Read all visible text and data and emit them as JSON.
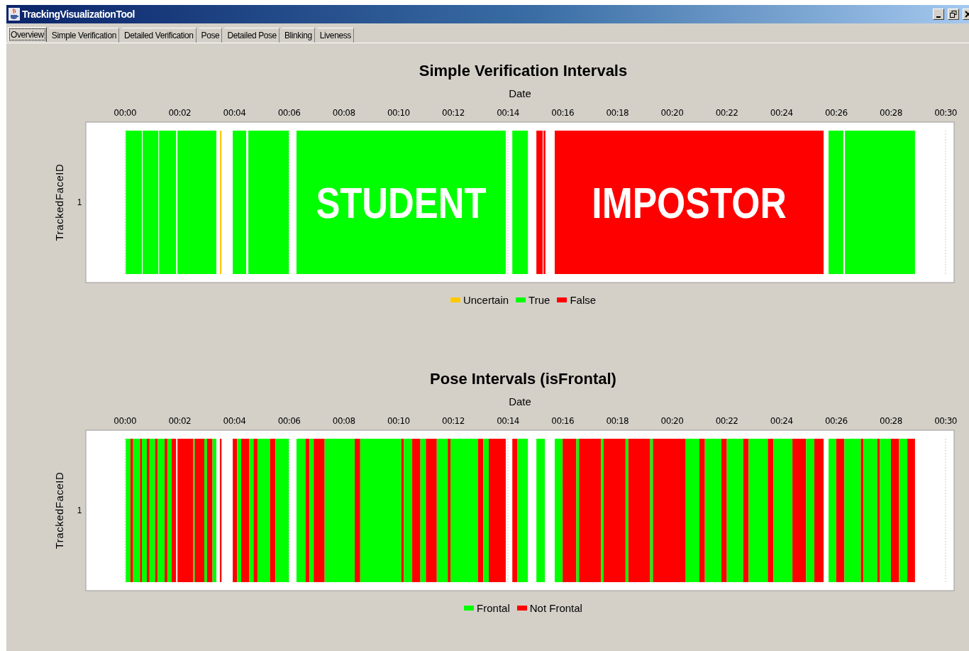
{
  "window": {
    "title": "TrackingVisualizationTool"
  },
  "tabs": [
    {
      "label": "Overview",
      "selected": true
    },
    {
      "label": "Simple Verification",
      "selected": false
    },
    {
      "label": "Detailed Verification",
      "selected": false
    },
    {
      "label": "Pose",
      "selected": false
    },
    {
      "label": "Detailed Pose",
      "selected": false
    },
    {
      "label": "Blinking",
      "selected": false
    },
    {
      "label": "Liveness",
      "selected": false
    }
  ],
  "charts": [
    {
      "legend": [
        {
          "name": "Uncertain",
          "color": "#ffc800"
        },
        {
          "name": "True",
          "color": "#00ff00"
        },
        {
          "name": "False",
          "color": "#ff0000"
        }
      ],
      "chart_data": {
        "type": "bar",
        "orientation": "horizontal",
        "grid": true,
        "title": "Simple Verification Intervals",
        "xlabel": "Date",
        "ylabel": "TrackedFaceID",
        "categories": [
          "1"
        ],
        "xlim": [
          -1.43,
          30.31
        ],
        "xticks": [
          {
            "value": 0,
            "label": "00:00"
          },
          {
            "value": 2,
            "label": "00:02"
          },
          {
            "value": 4,
            "label": "00:04"
          },
          {
            "value": 6,
            "label": "00:06"
          },
          {
            "value": 8,
            "label": "00:08"
          },
          {
            "value": 10,
            "label": "00:10"
          },
          {
            "value": 12,
            "label": "00:12"
          },
          {
            "value": 14,
            "label": "00:14"
          },
          {
            "value": 16,
            "label": "00:16"
          },
          {
            "value": 18,
            "label": "00:18"
          },
          {
            "value": 20,
            "label": "00:20"
          },
          {
            "value": 22,
            "label": "00:22"
          },
          {
            "value": 24,
            "label": "00:24"
          },
          {
            "value": 26,
            "label": "00:26"
          },
          {
            "value": 28,
            "label": "00:28"
          },
          {
            "value": 30,
            "label": "00:30"
          }
        ],
        "bands": [
          {
            "axis": "x",
            "from": 0.03,
            "to": 0.62,
            "color": "#00ff00"
          },
          {
            "axis": "x",
            "from": 0.65,
            "to": 1.22,
            "color": "#00ff00"
          },
          {
            "axis": "x",
            "from": 1.25,
            "to": 1.87,
            "color": "#00ff00"
          },
          {
            "axis": "x",
            "from": 1.92,
            "to": 3.34,
            "color": "#00ff00"
          },
          {
            "axis": "x",
            "from": 3.47,
            "to": 3.53,
            "color": "#ffc800"
          },
          {
            "axis": "x",
            "from": 3.94,
            "to": 4.43,
            "color": "#00ff00"
          },
          {
            "axis": "x",
            "from": 4.51,
            "to": 5.99,
            "color": "#00ff00"
          },
          {
            "axis": "x",
            "from": 6.27,
            "to": 13.92,
            "color": "#00ff00"
          },
          {
            "axis": "x",
            "from": 14.16,
            "to": 14.73,
            "color": "#00ff00"
          },
          {
            "axis": "x",
            "from": 15.04,
            "to": 15.27,
            "color": "#ff0000"
          },
          {
            "axis": "x",
            "from": 15.3,
            "to": 15.37,
            "color": "#ff0000"
          },
          {
            "axis": "x",
            "from": 15.71,
            "to": 25.54,
            "color": "#ff0000"
          },
          {
            "axis": "x",
            "from": 25.72,
            "to": 26.26,
            "color": "#00ff00"
          },
          {
            "axis": "x",
            "from": 26.32,
            "to": 28.88,
            "color": "#00ff00"
          }
        ],
        "annotations": [
          "STUDENT",
          "IMPOSTOR"
        ]
      }
    },
    {
      "legend": [
        {
          "name": "Frontal",
          "color": "#00ff00"
        },
        {
          "name": "Not Frontal",
          "color": "#ff0000"
        }
      ],
      "chart_data": {
        "type": "bar",
        "orientation": "horizontal",
        "grid": true,
        "title": "Pose Intervals (isFrontal)",
        "xlabel": "Date",
        "ylabel": "TrackedFaceID",
        "categories": [
          "1"
        ],
        "xlim": [
          -1.43,
          30.31
        ],
        "xticks": [
          {
            "value": 0,
            "label": "00:00"
          },
          {
            "value": 2,
            "label": "00:02"
          },
          {
            "value": 4,
            "label": "00:04"
          },
          {
            "value": 6,
            "label": "00:06"
          },
          {
            "value": 8,
            "label": "00:08"
          },
          {
            "value": 10,
            "label": "00:10"
          },
          {
            "value": 12,
            "label": "00:12"
          },
          {
            "value": 14,
            "label": "00:14"
          },
          {
            "value": 16,
            "label": "00:16"
          },
          {
            "value": 18,
            "label": "00:18"
          },
          {
            "value": 20,
            "label": "00:20"
          },
          {
            "value": 22,
            "label": "00:22"
          },
          {
            "value": 24,
            "label": "00:24"
          },
          {
            "value": 26,
            "label": "00:26"
          },
          {
            "value": 28,
            "label": "00:28"
          },
          {
            "value": 30,
            "label": "00:30"
          }
        ],
        "bands": [
          {
            "axis": "x",
            "from": 0.03,
            "to": 0.2,
            "color": "#00ff00"
          },
          {
            "axis": "x",
            "from": 0.2,
            "to": 0.3,
            "color": "#ff0000"
          },
          {
            "axis": "x",
            "from": 0.3,
            "to": 0.55,
            "color": "#00ff00"
          },
          {
            "axis": "x",
            "from": 0.55,
            "to": 0.62,
            "color": "#ff0000"
          },
          {
            "axis": "x",
            "from": 0.62,
            "to": 0.8,
            "color": "#00ff00"
          },
          {
            "axis": "x",
            "from": 0.8,
            "to": 0.9,
            "color": "#ff0000"
          },
          {
            "axis": "x",
            "from": 0.9,
            "to": 1.1,
            "color": "#00ff00"
          },
          {
            "axis": "x",
            "from": 1.1,
            "to": 1.2,
            "color": "#ff0000"
          },
          {
            "axis": "x",
            "from": 1.2,
            "to": 1.45,
            "color": "#00ff00"
          },
          {
            "axis": "x",
            "from": 1.45,
            "to": 1.55,
            "color": "#ff0000"
          },
          {
            "axis": "x",
            "from": 1.55,
            "to": 1.7,
            "color": "#00ff00"
          },
          {
            "axis": "x",
            "from": 1.7,
            "to": 1.87,
            "color": "#ff0000"
          },
          {
            "axis": "x",
            "from": 1.92,
            "to": 2.5,
            "color": "#ff0000"
          },
          {
            "axis": "x",
            "from": 2.5,
            "to": 2.55,
            "color": "#00ff00"
          },
          {
            "axis": "x",
            "from": 2.55,
            "to": 2.9,
            "color": "#ff0000"
          },
          {
            "axis": "x",
            "from": 2.9,
            "to": 3.0,
            "color": "#00ff00"
          },
          {
            "axis": "x",
            "from": 3.0,
            "to": 3.2,
            "color": "#ff0000"
          },
          {
            "axis": "x",
            "from": 3.2,
            "to": 3.34,
            "color": "#00ff00"
          },
          {
            "axis": "x",
            "from": 3.47,
            "to": 3.53,
            "color": "#ff0000"
          },
          {
            "axis": "x",
            "from": 3.94,
            "to": 4.1,
            "color": "#ff0000"
          },
          {
            "axis": "x",
            "from": 4.1,
            "to": 4.25,
            "color": "#00ff00"
          },
          {
            "axis": "x",
            "from": 4.25,
            "to": 4.55,
            "color": "#ff0000"
          },
          {
            "axis": "x",
            "from": 4.55,
            "to": 4.7,
            "color": "#00ff00"
          },
          {
            "axis": "x",
            "from": 4.7,
            "to": 4.85,
            "color": "#ff0000"
          },
          {
            "axis": "x",
            "from": 4.85,
            "to": 5.3,
            "color": "#00ff00"
          },
          {
            "axis": "x",
            "from": 5.3,
            "to": 5.5,
            "color": "#ff0000"
          },
          {
            "axis": "x",
            "from": 5.5,
            "to": 5.99,
            "color": "#00ff00"
          },
          {
            "axis": "x",
            "from": 6.27,
            "to": 6.6,
            "color": "#00ff00"
          },
          {
            "axis": "x",
            "from": 6.6,
            "to": 6.75,
            "color": "#ff0000"
          },
          {
            "axis": "x",
            "from": 6.75,
            "to": 6.9,
            "color": "#00ff00"
          },
          {
            "axis": "x",
            "from": 6.9,
            "to": 7.3,
            "color": "#ff0000"
          },
          {
            "axis": "x",
            "from": 7.3,
            "to": 8.4,
            "color": "#00ff00"
          },
          {
            "axis": "x",
            "from": 8.4,
            "to": 8.6,
            "color": "#ff0000"
          },
          {
            "axis": "x",
            "from": 8.6,
            "to": 10.1,
            "color": "#00ff00"
          },
          {
            "axis": "x",
            "from": 10.1,
            "to": 10.2,
            "color": "#ff0000"
          },
          {
            "axis": "x",
            "from": 10.2,
            "to": 10.5,
            "color": "#00ff00"
          },
          {
            "axis": "x",
            "from": 10.5,
            "to": 10.8,
            "color": "#ff0000"
          },
          {
            "axis": "x",
            "from": 10.8,
            "to": 11.0,
            "color": "#00ff00"
          },
          {
            "axis": "x",
            "from": 11.0,
            "to": 11.4,
            "color": "#ff0000"
          },
          {
            "axis": "x",
            "from": 11.4,
            "to": 11.8,
            "color": "#00ff00"
          },
          {
            "axis": "x",
            "from": 11.8,
            "to": 11.9,
            "color": "#ff0000"
          },
          {
            "axis": "x",
            "from": 11.9,
            "to": 12.9,
            "color": "#00ff00"
          },
          {
            "axis": "x",
            "from": 12.9,
            "to": 13.1,
            "color": "#ff0000"
          },
          {
            "axis": "x",
            "from": 13.1,
            "to": 13.3,
            "color": "#00ff00"
          },
          {
            "axis": "x",
            "from": 13.3,
            "to": 13.92,
            "color": "#ff0000"
          },
          {
            "axis": "x",
            "from": 14.16,
            "to": 14.35,
            "color": "#ff0000"
          },
          {
            "axis": "x",
            "from": 14.35,
            "to": 14.73,
            "color": "#00ff00"
          },
          {
            "axis": "x",
            "from": 15.04,
            "to": 15.35,
            "color": "#00ff00"
          },
          {
            "axis": "x",
            "from": 15.71,
            "to": 16.0,
            "color": "#00ff00"
          },
          {
            "axis": "x",
            "from": 16.0,
            "to": 16.5,
            "color": "#ff0000"
          },
          {
            "axis": "x",
            "from": 16.5,
            "to": 16.6,
            "color": "#00ff00"
          },
          {
            "axis": "x",
            "from": 16.6,
            "to": 17.4,
            "color": "#ff0000"
          },
          {
            "axis": "x",
            "from": 17.4,
            "to": 17.5,
            "color": "#00ff00"
          },
          {
            "axis": "x",
            "from": 17.5,
            "to": 18.3,
            "color": "#ff0000"
          },
          {
            "axis": "x",
            "from": 18.3,
            "to": 18.4,
            "color": "#00ff00"
          },
          {
            "axis": "x",
            "from": 18.4,
            "to": 19.2,
            "color": "#ff0000"
          },
          {
            "axis": "x",
            "from": 19.2,
            "to": 19.3,
            "color": "#00ff00"
          },
          {
            "axis": "x",
            "from": 19.3,
            "to": 20.5,
            "color": "#ff0000"
          },
          {
            "axis": "x",
            "from": 20.5,
            "to": 21.0,
            "color": "#00ff00"
          },
          {
            "axis": "x",
            "from": 21.0,
            "to": 21.2,
            "color": "#ff0000"
          },
          {
            "axis": "x",
            "from": 21.2,
            "to": 21.8,
            "color": "#00ff00"
          },
          {
            "axis": "x",
            "from": 21.8,
            "to": 22.0,
            "color": "#ff0000"
          },
          {
            "axis": "x",
            "from": 22.0,
            "to": 22.6,
            "color": "#00ff00"
          },
          {
            "axis": "x",
            "from": 22.6,
            "to": 22.8,
            "color": "#ff0000"
          },
          {
            "axis": "x",
            "from": 22.8,
            "to": 23.5,
            "color": "#00ff00"
          },
          {
            "axis": "x",
            "from": 23.5,
            "to": 23.7,
            "color": "#ff0000"
          },
          {
            "axis": "x",
            "from": 23.7,
            "to": 24.4,
            "color": "#00ff00"
          },
          {
            "axis": "x",
            "from": 24.4,
            "to": 24.9,
            "color": "#ff0000"
          },
          {
            "axis": "x",
            "from": 24.9,
            "to": 25.2,
            "color": "#00ff00"
          },
          {
            "axis": "x",
            "from": 25.2,
            "to": 25.54,
            "color": "#ff0000"
          },
          {
            "axis": "x",
            "from": 25.72,
            "to": 26.0,
            "color": "#00ff00"
          },
          {
            "axis": "x",
            "from": 26.0,
            "to": 26.3,
            "color": "#ff0000"
          },
          {
            "axis": "x",
            "from": 26.3,
            "to": 26.9,
            "color": "#00ff00"
          },
          {
            "axis": "x",
            "from": 26.9,
            "to": 27.0,
            "color": "#ff0000"
          },
          {
            "axis": "x",
            "from": 27.0,
            "to": 27.5,
            "color": "#00ff00"
          },
          {
            "axis": "x",
            "from": 27.5,
            "to": 27.6,
            "color": "#ff0000"
          },
          {
            "axis": "x",
            "from": 27.6,
            "to": 28.0,
            "color": "#00ff00"
          },
          {
            "axis": "x",
            "from": 28.0,
            "to": 28.3,
            "color": "#ff0000"
          },
          {
            "axis": "x",
            "from": 28.3,
            "to": 28.6,
            "color": "#00ff00"
          },
          {
            "axis": "x",
            "from": 28.6,
            "to": 28.88,
            "color": "#ff0000"
          }
        ]
      }
    }
  ]
}
